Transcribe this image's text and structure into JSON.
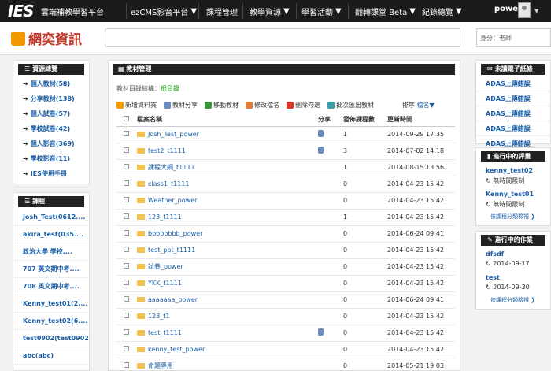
{
  "topbar": {
    "logo": "IES",
    "brand": "雲端補教學習平台",
    "nav": [
      "ezCMS影音平台",
      "課程管理",
      "教學資源",
      "學習活動",
      "翻轉課堂 Beta",
      "紀錄總覽"
    ],
    "user": "power"
  },
  "header": {
    "site_name": "網奕資訊",
    "identity": "身分：老師"
  },
  "resources": {
    "title": "資源總覽",
    "items": [
      "個人教材(58)",
      "分享教材(138)",
      "個人試卷(57)",
      "學校試卷(42)",
      "個人影音(369)",
      "學校影音(11)",
      "IES使用手冊"
    ]
  },
  "courses": {
    "title": "課程",
    "items": [
      "Josh_Test(0612....",
      "akira_test(035....",
      "政治大學 學校....",
      "707 英文期中考....",
      "708 英文期中考....",
      "Kenny_test01(2....",
      "Kenny_test02(6....",
      "test0902(test0902)",
      "abc(abc)"
    ]
  },
  "main": {
    "title": "教材管理",
    "breadcrumb_label": "教材目錄結構：",
    "breadcrumb_current": "根目錄",
    "toolbar": [
      "新增資料夾",
      "教材分享",
      "移動教材",
      "修改檔名",
      "刪除勾選",
      "批次匯出教材"
    ],
    "sort_label": "排序",
    "sort_value": "檔名▼",
    "columns": [
      "檔案名稱",
      "分享",
      "發佈課程數",
      "更新時間"
    ],
    "rows": [
      {
        "name": "Josh_Test_power",
        "shared": true,
        "count": "1",
        "time": "2014-09-29 17:35"
      },
      {
        "name": "test2_t1111",
        "shared": true,
        "count": "3",
        "time": "2014-07-02 14:18"
      },
      {
        "name": "課程大綱_t1111",
        "shared": false,
        "count": "1",
        "time": "2014-08-15 13:56"
      },
      {
        "name": "class1_t1111",
        "shared": false,
        "count": "0",
        "time": "2014-04-23 15:42"
      },
      {
        "name": "Weather_power",
        "shared": false,
        "count": "0",
        "time": "2014-04-23 15:42"
      },
      {
        "name": "123_t1111",
        "shared": false,
        "count": "1",
        "time": "2014-04-23 15:42"
      },
      {
        "name": "bbbbbbbb_power",
        "shared": false,
        "count": "0",
        "time": "2014-06-24 09:41"
      },
      {
        "name": "test_ppt_t1111",
        "shared": false,
        "count": "0",
        "time": "2014-04-23 15:42"
      },
      {
        "name": "試卷_power",
        "shared": false,
        "count": "0",
        "time": "2014-04-23 15:42"
      },
      {
        "name": "YKK_t1111",
        "shared": false,
        "count": "0",
        "time": "2014-04-23 15:42"
      },
      {
        "name": "aaaaaaa_power",
        "shared": false,
        "count": "0",
        "time": "2014-06-24 09:41"
      },
      {
        "name": "123_t1",
        "shared": false,
        "count": "0",
        "time": "2014-04-23 15:42"
      },
      {
        "name": "test_t1111",
        "shared": true,
        "count": "0",
        "time": "2014-04-23 15:42"
      },
      {
        "name": "kenny_test_power",
        "shared": false,
        "count": "0",
        "time": "2014-04-23 15:42"
      },
      {
        "name": "命題專用",
        "shared": false,
        "count": "0",
        "time": "2014-05-21 19:03"
      }
    ]
  },
  "unread": {
    "title": "未讀電子紙條",
    "items": [
      "ADAS上傳錯誤",
      "ADAS上傳錯誤",
      "ADAS上傳錯誤",
      "ADAS上傳錯誤",
      "ADAS上傳錯誤"
    ]
  },
  "evaluations": {
    "title": "進行中的評量",
    "items": [
      {
        "name": "kenny_test02",
        "status": "無時間限制"
      },
      {
        "name": "Kenny_test01",
        "status": "無時間限制"
      }
    ],
    "more": "依課程分類檢視"
  },
  "homework": {
    "title": "進行中的作業",
    "items": [
      {
        "name": "dfsdf",
        "date": "2014-09-17"
      },
      {
        "name": "test",
        "date": "2014-09-30"
      }
    ],
    "more": "依課程分類檢視"
  },
  "colors": {
    "topbar": "#1b1b1b",
    "panel_header": "#222222",
    "link": "#1a5fa8",
    "breadcrumb_current": "#1a9b1a",
    "logo_red": "#c0392b",
    "folder": "#f2c14e"
  },
  "icons": {
    "resources": "list-icon",
    "courses": "list-icon",
    "main": "table-icon",
    "unread": "envelope-icon",
    "evaluations": "bookmark-icon",
    "homework": "pencil-icon"
  }
}
